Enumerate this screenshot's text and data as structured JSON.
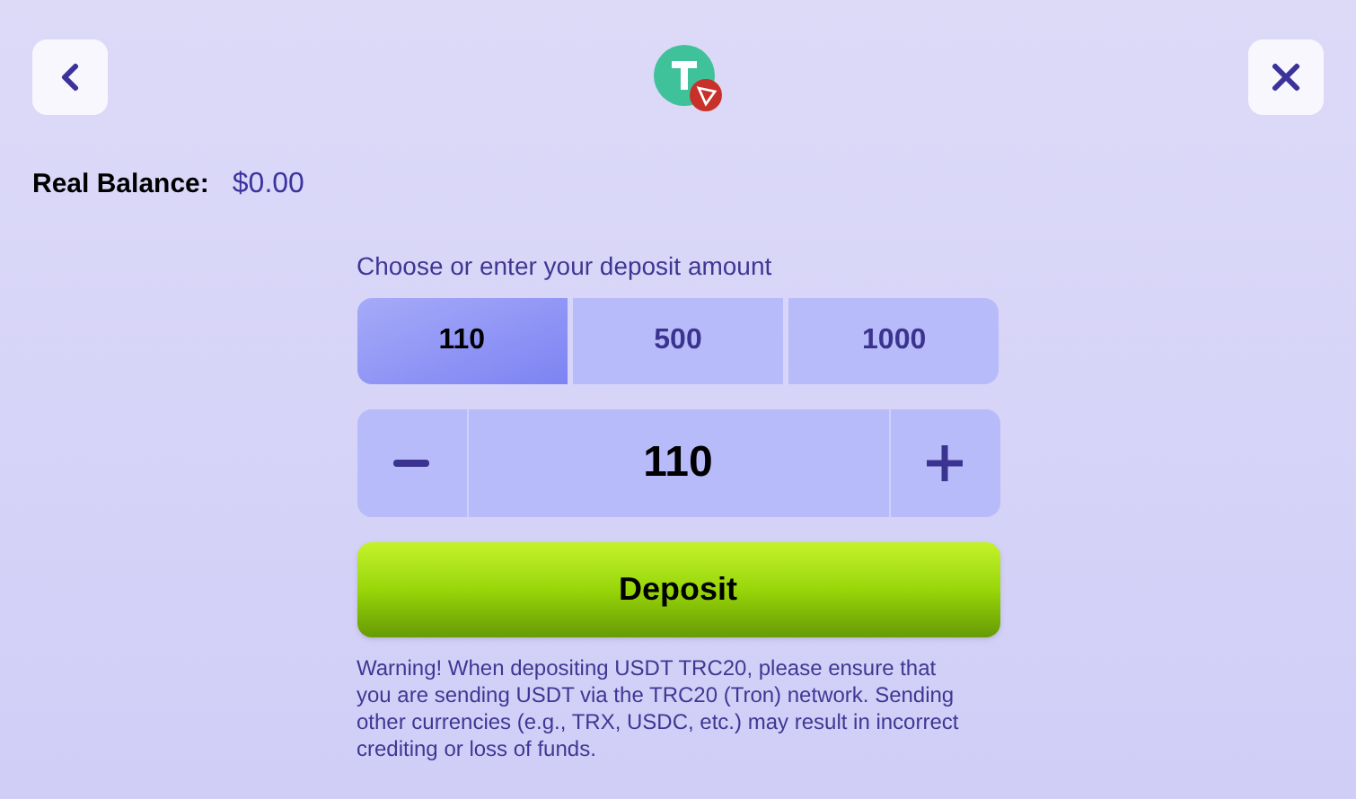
{
  "balance": {
    "label": "Real Balance:",
    "value": "$0.00"
  },
  "amount": {
    "prompt": "Choose or enter your deposit amount",
    "presets": [
      {
        "label": "110",
        "selected": true
      },
      {
        "label": "500",
        "selected": false
      },
      {
        "label": "1000",
        "selected": false
      }
    ],
    "value": "110"
  },
  "deposit_button": "Deposit",
  "warning": "Warning! When depositing USDT TRC20, please ensure that you are sending USDT via the TRC20 (Tron) network. Sending other currencies (e.g., TRX, USDC, etc.) may result in incorrect crediting or loss of funds."
}
